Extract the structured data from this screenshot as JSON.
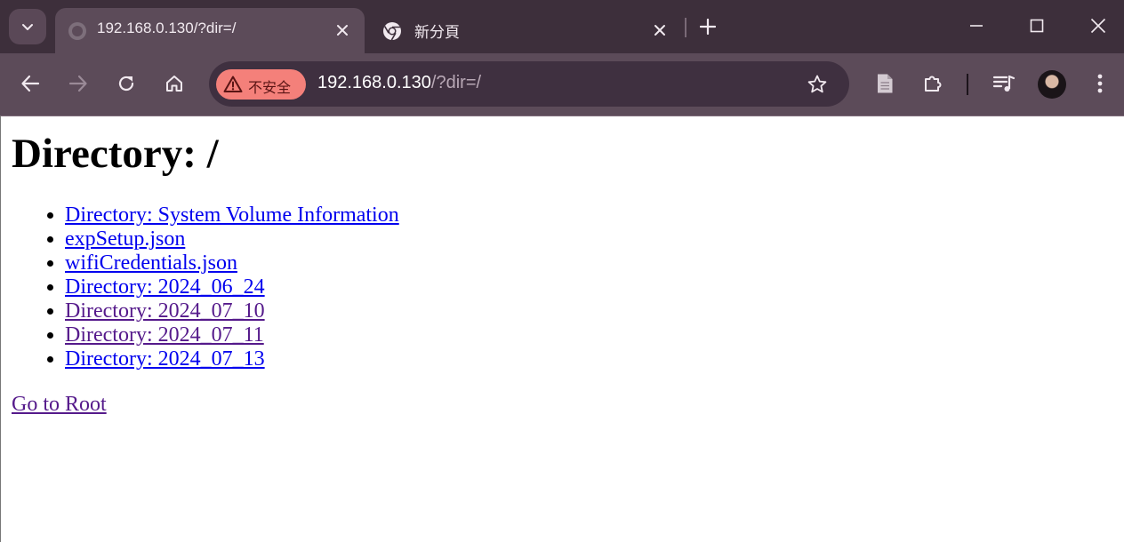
{
  "browser": {
    "tabs": [
      {
        "title": "192.168.0.130/?dir=/",
        "active": true
      },
      {
        "title": "新分頁",
        "active": false
      }
    ],
    "address": {
      "security_label": "不安全",
      "url_host": "192.168.0.130",
      "url_path": "/?dir=/"
    },
    "colors": {
      "tabstrip": "#3d2f3b",
      "toolbar": "#5c4b59",
      "omnibox": "#3f3040",
      "security_chip": "#f4807a"
    }
  },
  "page": {
    "heading": "Directory: /",
    "entries": [
      {
        "label": "Directory: System Volume Information",
        "visited": false
      },
      {
        "label": "expSetup.json",
        "visited": false
      },
      {
        "label": "wifiCredentials.json",
        "visited": false
      },
      {
        "label": "Directory: 2024_06_24",
        "visited": false
      },
      {
        "label": "Directory: 2024_07_10",
        "visited": true
      },
      {
        "label": "Directory: 2024_07_11",
        "visited": true
      },
      {
        "label": "Directory: 2024_07_13",
        "visited": false
      }
    ],
    "root_link": "Go to Root",
    "link_color": "#0000ee",
    "visited_color": "#551a8b"
  }
}
